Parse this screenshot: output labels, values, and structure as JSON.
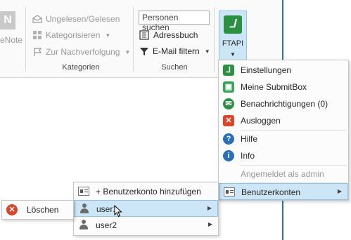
{
  "ribbon": {
    "onenote_label": "eNote",
    "tags": {
      "unread_read": "Ungelesen/Gelesen",
      "categorize": "Kategorisieren",
      "followup": "Zur Nachverfolgung",
      "group_label": "Kategorien"
    },
    "find": {
      "search_people_value": "Personen suchen",
      "address_book": "Adressbuch",
      "filter_email": "E-Mail filtern",
      "group_label": "Suchen"
    },
    "ftapi": {
      "label": "FTAPI"
    }
  },
  "ftapi_menu": {
    "items": [
      {
        "label": "Einstellungen",
        "icon": "ftapi-logo-icon"
      },
      {
        "label": "Meine SubmitBox",
        "icon": "submitbox-icon"
      },
      {
        "label": "Benachrichtigungen (0)",
        "icon": "mail-icon"
      },
      {
        "label": "Ausloggen",
        "icon": "close-icon"
      },
      {
        "label": "Hilfe",
        "icon": "help-icon"
      },
      {
        "label": "Info",
        "icon": "info-icon"
      }
    ],
    "logged_in_as": "Angemeldet als admin",
    "accounts": "Benutzerkonten"
  },
  "accounts_menu": {
    "add_account": "+ Benutzerkonto hinzufügen",
    "users": [
      "user1",
      "user2"
    ]
  },
  "user_menu": {
    "delete": "Löschen"
  },
  "colors": {
    "highlight": "#cde6f7",
    "highlight_border": "#91c3e6",
    "ftapi_green": "#2a9142",
    "accent_blue": "#2b6fb6"
  }
}
